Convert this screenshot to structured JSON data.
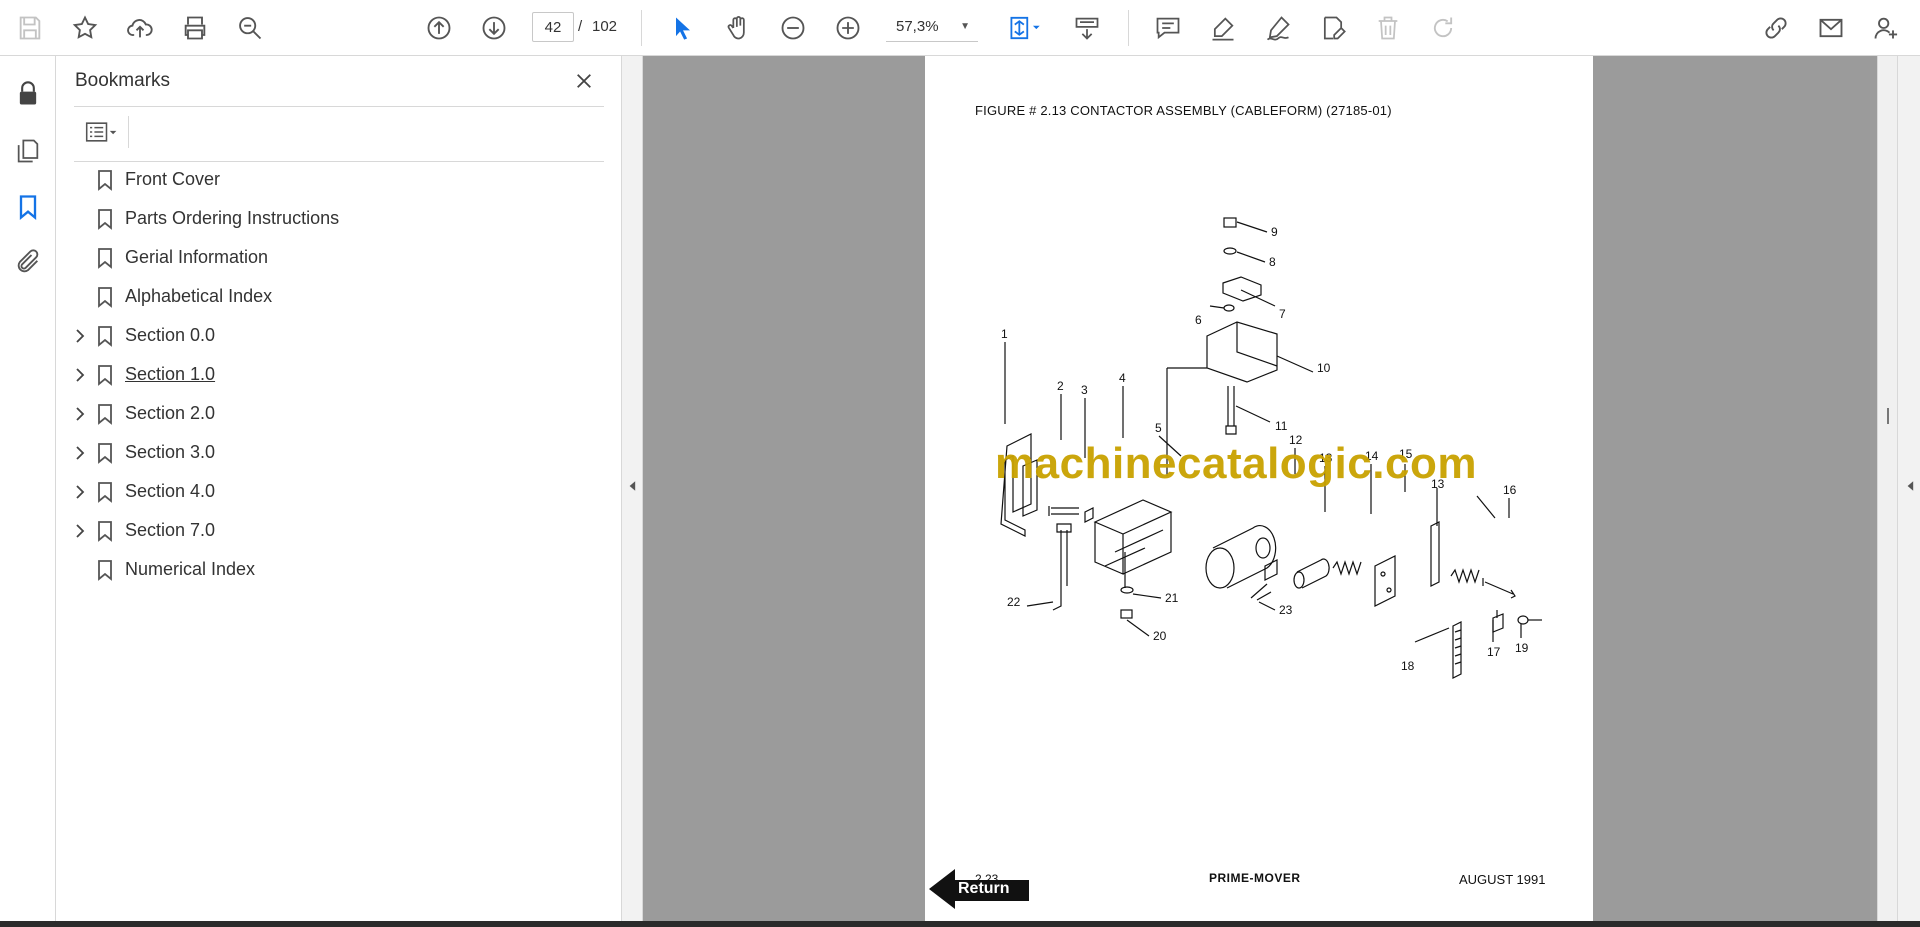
{
  "toolbar": {
    "page_current": "42",
    "page_separator": "/",
    "page_total": "102",
    "zoom": "57,3%"
  },
  "sidebar_panel": {
    "title": "Bookmarks",
    "bookmarks": [
      {
        "label": "Front Cover",
        "expandable": false
      },
      {
        "label": "Parts Ordering Instructions",
        "expandable": false
      },
      {
        "label": "Gerial Information",
        "expandable": false
      },
      {
        "label": "Alphabetical Index",
        "expandable": false
      },
      {
        "label": "Section 0.0",
        "expandable": true
      },
      {
        "label": "Section 1.0",
        "expandable": true
      },
      {
        "label": "Section 2.0",
        "expandable": true
      },
      {
        "label": "Section 3.0",
        "expandable": true
      },
      {
        "label": "Section 4.0",
        "expandable": true
      },
      {
        "label": "Section 7.0",
        "expandable": true
      },
      {
        "label": "Numerical Index",
        "expandable": false
      }
    ]
  },
  "document": {
    "figure_title": "FIGURE # 2.13  CONTACTOR ASSEMBLY (CABLEFORM) (27185-01)",
    "callouts": [
      "1",
      "2",
      "3",
      "4",
      "5",
      "6",
      "7",
      "8",
      "9",
      "10",
      "11",
      "12",
      "13",
      "13",
      "14",
      "15",
      "16",
      "17",
      "18",
      "19",
      "20",
      "21",
      "22",
      "23"
    ],
    "page_number": "2.23",
    "return_label": "Return",
    "logo_text": "PRIME-MOVER",
    "date": "AUGUST 1991",
    "watermark": "machinecatalogic.com"
  },
  "colors": {
    "accent": "#1473e6",
    "viewer_bg": "#9b9b9b",
    "watermark": "#c9a200"
  }
}
